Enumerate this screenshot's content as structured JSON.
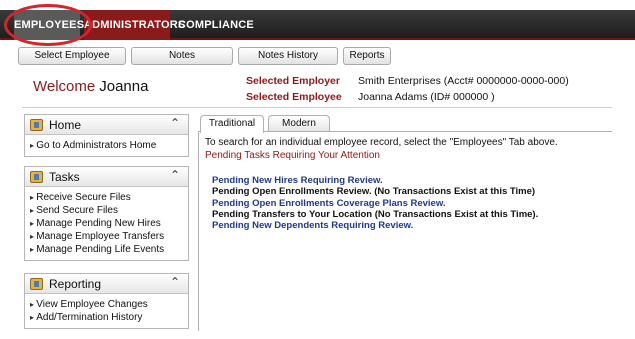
{
  "nav": {
    "tabs": [
      {
        "label": "EMPLOYEES",
        "active": true
      },
      {
        "label": "ADMINISTRATORS"
      },
      {
        "label": "COMPLIANCE"
      }
    ]
  },
  "toolbar": {
    "select_employee": "Select Employee",
    "notes": "Notes",
    "notes_history": "Notes History",
    "reports": "Reports"
  },
  "header": {
    "welcome": "Welcome",
    "user": "Joanna",
    "selected_employer_label": "Selected Employer",
    "selected_employer_value": "Smith Enterprises (Acct# 0000000-0000-000)",
    "selected_employee_label": "Selected Employee",
    "selected_employee_value": "Joanna Adams (ID# 000000 )"
  },
  "sidebar": {
    "home": {
      "title": "Home",
      "links": [
        "Go to Administrators Home"
      ]
    },
    "tasks": {
      "title": "Tasks",
      "links": [
        "Receive Secure Files",
        "Send Secure Files",
        "Manage Pending New Hires",
        "Manage Employee Transfers",
        "Manage Pending Life Events"
      ]
    },
    "reporting": {
      "title": "Reporting",
      "links": [
        "View Employee Changes",
        "Add/Termination History"
      ]
    }
  },
  "main": {
    "tabs": [
      "Traditional",
      "Modern"
    ],
    "instruction": "To search for an individual employee record, select the \"Employees\" Tab above.",
    "pending_heading": "Pending Tasks Requiring Your Attention",
    "items": [
      "Pending New Hires Requiring Review.",
      "Pending Open Enrollments Review. (No Transactions Exist at this Time)",
      "Pending Open Enrollments Coverage Plans Review.",
      "Pending Transfers to Your Location (No Transactions Exist at this Time).",
      "Pending New Dependents Requiring Review."
    ]
  },
  "colors": {
    "brand_red": "#8b1a1a",
    "link_blue": "#1f3a8a",
    "highlight": "#d4252b"
  }
}
